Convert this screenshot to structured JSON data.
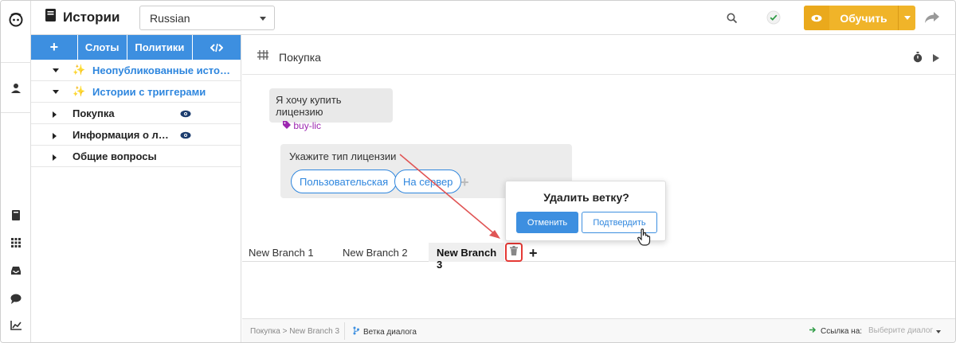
{
  "header": {
    "title": "Истории",
    "language": "Russian",
    "train_label": "Обучить"
  },
  "sidebar": {
    "tabs": [
      {
        "label": "+"
      },
      {
        "label": "Слоты"
      },
      {
        "label": "Политики"
      },
      {
        "label": "</>"
      }
    ],
    "items": [
      {
        "label": "Неопубликованные истор…",
        "expanded": true,
        "special": true
      },
      {
        "label": "Истории с триггерами",
        "expanded": true,
        "special": true
      },
      {
        "label": "Покупка",
        "expanded": false,
        "visible_icon": true
      },
      {
        "label": "Информация о ли…",
        "expanded": false,
        "visible_icon": true
      },
      {
        "label": "Общие вопросы",
        "expanded": false,
        "visible_icon": false
      }
    ]
  },
  "story": {
    "title": "Покупка",
    "user_message": "Я хочу купить лицензию",
    "intent": "buy-lic",
    "bot_question": "Укажите тип лицензии",
    "quick_replies": [
      "Пользовательская",
      "На сервер"
    ]
  },
  "branches": {
    "tabs": [
      "New Branch 1",
      "New Branch 2",
      "New Branch 3"
    ],
    "active": "New Branch 3"
  },
  "popover": {
    "title": "Удалить ветку?",
    "cancel": "Отменить",
    "confirm": "Подтвердить"
  },
  "footer": {
    "breadcrumb": "Покупка > New Branch 3",
    "branch_label": "Ветка диалога",
    "link_label": "Ссылка на:",
    "link_placeholder": "Выберите диалог"
  },
  "colors": {
    "primary": "#3d8fe0",
    "accent": "#f0b429",
    "intent": "#9c27b0",
    "highlight": "#e53935"
  }
}
